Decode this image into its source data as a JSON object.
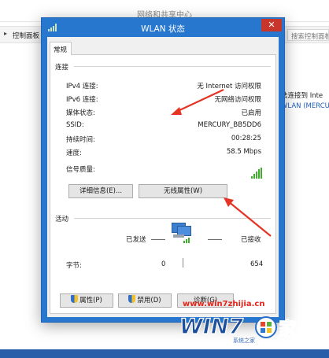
{
  "background_window": {
    "title": "网络和共享中心",
    "breadcrumb": "控制面板",
    "search_placeholder": "搜索控制面板",
    "side_text_1": "法连接到 Inte",
    "side_text_2": "WLAN (MERCU"
  },
  "dialog": {
    "title": "WLAN 状态",
    "close_glyph": "✕",
    "tab_general": "常规",
    "connection": {
      "group_label": "连接",
      "rows": [
        {
          "label": "IPv4 连接:",
          "value": "无 Internet 访问权限"
        },
        {
          "label": "IPv6 连接:",
          "value": "无网络访问权限"
        },
        {
          "label": "媒体状态:",
          "value": "已启用"
        },
        {
          "label": "SSID:",
          "value": "MERCURY_BB5DD6"
        },
        {
          "label": "持续时间:",
          "value": "00:28:25"
        },
        {
          "label": "速度:",
          "value": "58.5 Mbps"
        }
      ],
      "signal_label": "信号质量:",
      "signal_bars": 5,
      "details_button": "详细信息(E)...",
      "wireless_props_button": "无线属性(W)"
    },
    "activity": {
      "group_label": "活动",
      "sent_label": "已发送",
      "received_label": "已接收",
      "bytes_label": "字节:",
      "bytes_sent": "0",
      "bytes_received": "654"
    },
    "buttons": {
      "properties": "属性(P)",
      "disable": "禁用(D)",
      "diagnose": "诊断(G)"
    }
  },
  "watermark": {
    "url": "www.win7zhijia.cn",
    "logo_text": "WIN7",
    "logo_suffix": "家",
    "logo_subtext": "系统之家"
  },
  "colors": {
    "titlebar": "#2777cf",
    "close_button": "#c7352b",
    "signal": "#3fae2a",
    "arrow": "#e53324",
    "watermark": "#e3261b"
  }
}
